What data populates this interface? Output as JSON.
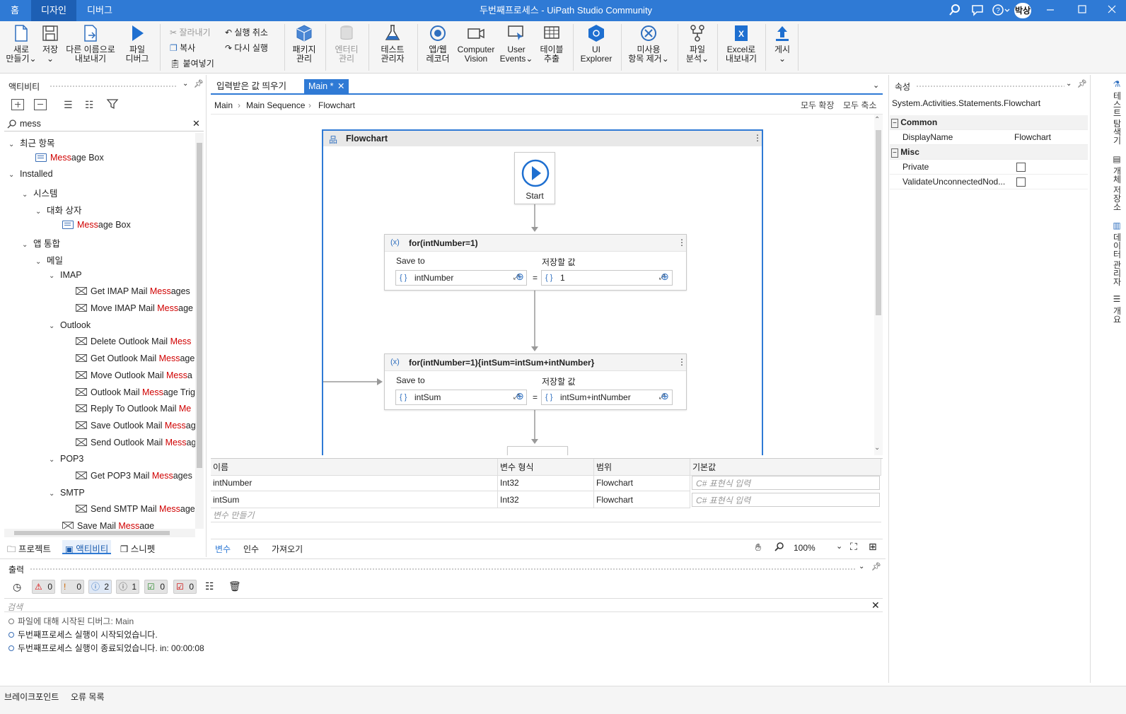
{
  "titlebar": {
    "tabs": [
      "홈",
      "디자인",
      "디버그"
    ],
    "title": "두번째프로세스 - UiPath Studio Community",
    "user": "박상"
  },
  "ribbon": {
    "new": "새로\n만들기",
    "save": "저장",
    "export": "다른 이름으로\n내보내기",
    "debug": "파일\n디버그",
    "cut": "잘라내기",
    "copy": "복사",
    "paste": "붙여넣기",
    "undo": "실행 취소",
    "redo": "다시 실행",
    "packages": "패키지\n관리",
    "entities": "엔터티\n관리",
    "test": "테스트\n관리자",
    "recorder": "앱/웹\n레코더",
    "cv": "Computer\nVision",
    "events": "User\nEvents",
    "table": "테이블\n추출",
    "uiexplorer": "UI\nExplorer",
    "remove": "미사용\n항목 제거",
    "analyze": "파일\n분석",
    "excel": "Excel로\n내보내기",
    "publish": "게시"
  },
  "activities": {
    "title": "액티비티",
    "search": "mess",
    "tree": [
      {
        "label": "최근 항목",
        "pre": "",
        "hl": "",
        "post": "",
        "level": 0,
        "type": "group"
      },
      {
        "label": "",
        "pre": "",
        "hl": "Mess",
        "post": "age Box",
        "level": 2,
        "type": "act"
      },
      {
        "label": "Installed",
        "pre": "",
        "hl": "",
        "post": "",
        "level": 0,
        "type": "group"
      },
      {
        "label": "시스템",
        "pre": "",
        "hl": "",
        "post": "",
        "level": 1,
        "type": "group"
      },
      {
        "label": "대화 상자",
        "pre": "",
        "hl": "",
        "post": "",
        "level": 2,
        "type": "group"
      },
      {
        "label": "",
        "pre": "",
        "hl": "Mess",
        "post": "age Box",
        "level": 4,
        "type": "act"
      },
      {
        "label": "앱 통합",
        "pre": "",
        "hl": "",
        "post": "",
        "level": 1,
        "type": "group"
      },
      {
        "label": "메일",
        "pre": "",
        "hl": "",
        "post": "",
        "level": 2,
        "type": "group"
      },
      {
        "label": "IMAP",
        "pre": "",
        "hl": "",
        "post": "",
        "level": 3,
        "type": "group"
      },
      {
        "label": "",
        "pre": "Get IMAP Mail ",
        "hl": "Mess",
        "post": "ages",
        "level": 5,
        "type": "mail"
      },
      {
        "label": "",
        "pre": "Move IMAP Mail ",
        "hl": "Mess",
        "post": "age",
        "level": 5,
        "type": "mail"
      },
      {
        "label": "Outlook",
        "pre": "",
        "hl": "",
        "post": "",
        "level": 3,
        "type": "group"
      },
      {
        "label": "",
        "pre": "Delete Outlook Mail ",
        "hl": "Mess",
        "post": "",
        "level": 5,
        "type": "mail"
      },
      {
        "label": "",
        "pre": "Get Outlook Mail ",
        "hl": "Mess",
        "post": "age",
        "level": 5,
        "type": "mail"
      },
      {
        "label": "",
        "pre": "Move Outlook Mail ",
        "hl": "Mess",
        "post": "a",
        "level": 5,
        "type": "mail"
      },
      {
        "label": "",
        "pre": "Outlook Mail ",
        "hl": "Mess",
        "post": "age Trig",
        "level": 5,
        "type": "mail"
      },
      {
        "label": "",
        "pre": "Reply To Outlook Mail ",
        "hl": "Me",
        "post": "",
        "level": 5,
        "type": "mail"
      },
      {
        "label": "",
        "pre": "Save Outlook Mail ",
        "hl": "Mess",
        "post": "ag",
        "level": 5,
        "type": "mail"
      },
      {
        "label": "",
        "pre": "Send Outlook Mail ",
        "hl": "Mess",
        "post": "ag",
        "level": 5,
        "type": "mail"
      },
      {
        "label": "POP3",
        "pre": "",
        "hl": "",
        "post": "",
        "level": 3,
        "type": "group"
      },
      {
        "label": "",
        "pre": "Get POP3 Mail ",
        "hl": "Mess",
        "post": "ages",
        "level": 5,
        "type": "mail"
      },
      {
        "label": "SMTP",
        "pre": "",
        "hl": "",
        "post": "",
        "level": 3,
        "type": "group"
      },
      {
        "label": "",
        "pre": "Send SMTP Mail ",
        "hl": "Mess",
        "post": "age",
        "level": 5,
        "type": "mail"
      },
      {
        "label": "",
        "pre": "Save Mail ",
        "hl": "Mess",
        "post": "age",
        "level": 4,
        "type": "mail"
      }
    ],
    "bottom_tabs": [
      "프로젝트",
      "액티비티",
      "스니펫"
    ]
  },
  "doc_tabs": [
    "입력받은 값 띄우기",
    "Main *"
  ],
  "breadcrumb": [
    "Main",
    "Main Sequence",
    "Flowchart"
  ],
  "expand_all": "모두 확장",
  "collapse_all": "모두 축소",
  "flowchart": {
    "title": "Flowchart",
    "start": "Start",
    "assign1": {
      "title": "for(intNumber=1)",
      "save_to": "Save to",
      "value_label": "저장할 값",
      "to": "intNumber",
      "value": "1"
    },
    "assign2": {
      "title": "for(intNumber=1){intSum=intSum+intNumber}",
      "save_to": "Save to",
      "value_label": "저장할 값",
      "to": "intSum",
      "value": "intSum+intNumber"
    }
  },
  "variables": {
    "headers": [
      "이름",
      "변수 형식",
      "범위",
      "기본값"
    ],
    "rows": [
      {
        "name": "intNumber",
        "type": "Int32",
        "scope": "Flowchart",
        "default": "C# 표현식 입력"
      },
      {
        "name": "intSum",
        "type": "Int32",
        "scope": "Flowchart",
        "default": "C# 표현식 입력"
      }
    ],
    "create": "변수 만들기",
    "tabs": [
      "변수",
      "인수",
      "가져오기"
    ],
    "zoom": "100%"
  },
  "properties": {
    "title": "속성",
    "class": "System.Activities.Statements.Flowchart",
    "common": "Common",
    "display_name_label": "DisplayName",
    "display_name": "Flowchart",
    "misc": "Misc",
    "private": "Private",
    "validate": "ValidateUnconnectedNod..."
  },
  "right_tabs": [
    "테스트 탐색기",
    "개체 저장소",
    "데이터 관리자",
    "개요"
  ],
  "output": {
    "title": "출력",
    "counts": [
      "0",
      "0",
      "2",
      "1",
      "0",
      "0"
    ],
    "search": "검색",
    "lines": [
      "파일에 대해 시작된 디버그: Main",
      "두번째프로세스 실행이 시작되었습니다.",
      "두번째프로세스 실행이 종료되었습니다. in: 00:00:08"
    ]
  },
  "status": {
    "breakpoints": "브레이크포인트",
    "errors": "오류 목록"
  },
  "colors": {
    "accent": "#2f7ad5",
    "highlight": "#d00000"
  }
}
